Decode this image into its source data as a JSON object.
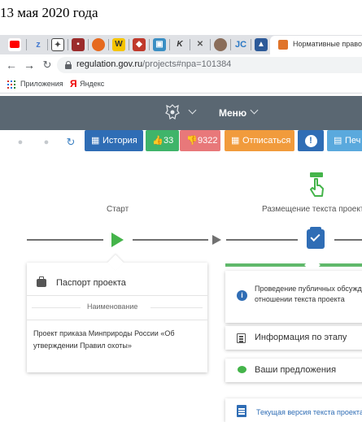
{
  "caption": "13 мая 2020 года",
  "browser": {
    "tab_title": "Нормативные правовые",
    "url_host": "regulation.gov.ru",
    "url_path": "/projects#npa=101384"
  },
  "bookmarks": {
    "apps": "Приложения",
    "yandex": "Яндекс"
  },
  "site_header": {
    "menu": "Меню"
  },
  "toolbar": {
    "history": "История",
    "likes": "33",
    "dislikes": "9322",
    "unsubscribe": "Отписаться",
    "print": "Печ"
  },
  "stages": {
    "start": "Старт",
    "placement": "Размещение текста проект"
  },
  "left_card": {
    "passport": "Паспорт проекта",
    "name_header": "Наименование",
    "name_value": "Проект приказа Минприроды России «Об утверждении Правил охоты»"
  },
  "right_panel": {
    "discussion": "Проведение публичных обсужд отношении текста проекта",
    "stage_info": "Информация по этапу",
    "proposals": "Ваши предложения",
    "current_version": "Текущая версия текста проекта"
  },
  "colors": {
    "header_bg": "#5a6772",
    "history_btn": "#2f6db5",
    "likes_btn": "#3fb46a",
    "dislikes_btn": "#e8787a",
    "unsubscribe_btn": "#f19b3c",
    "info_btn": "#2f6db5",
    "print_btn": "#5aa9dd",
    "accent_green": "#5fb86a",
    "play_green": "#44b44a"
  }
}
